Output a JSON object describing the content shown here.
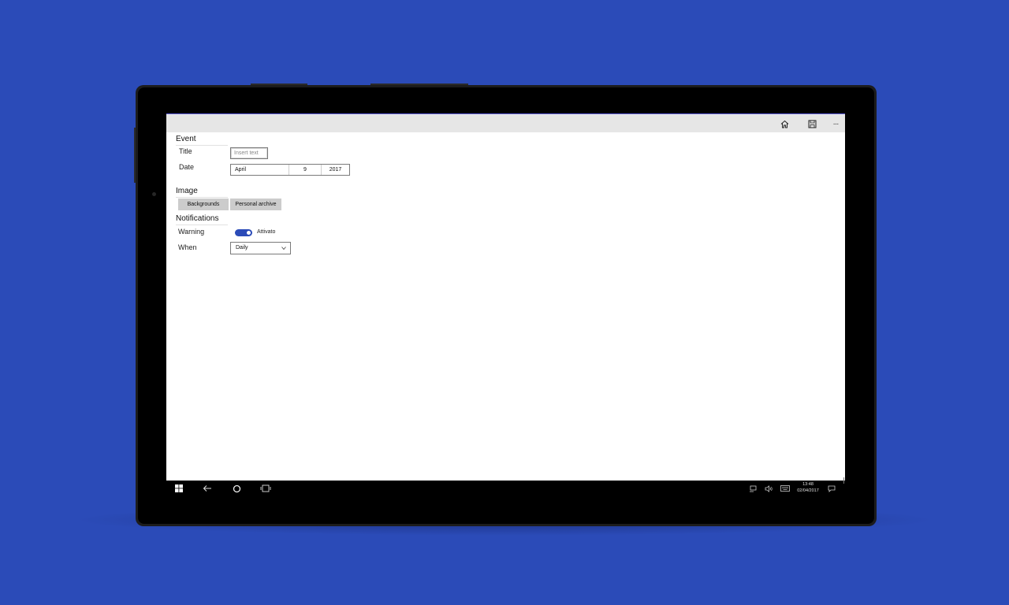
{
  "colors": {
    "background": "#2b4bb8",
    "accent": "#2b4bb8",
    "command_bar": "#e6e6e6",
    "taskbar": "#000000"
  },
  "command_bar": {
    "icons": [
      "home-icon",
      "save-icon",
      "more-icon"
    ],
    "more_label": "···"
  },
  "event": {
    "header": "Event",
    "title_label": "Title",
    "title_placeholder": "Insert text",
    "date_label": "Date",
    "date": {
      "month": "April",
      "day": "9",
      "year": "2017"
    }
  },
  "image": {
    "header": "Image",
    "buttons": [
      "Backgrounds",
      "Personal archive"
    ]
  },
  "notifications": {
    "header": "Notifications",
    "warning_label": "Warning",
    "toggle_state_label": "Attivato",
    "toggle_on": true,
    "when_label": "When",
    "when_value": "Daily"
  },
  "taskbar": {
    "icons": [
      "windows-icon",
      "back-icon",
      "search-icon",
      "task-view-icon"
    ],
    "tray_icons": [
      "network-icon",
      "volume-icon",
      "keyboard-icon",
      "action-center-icon"
    ],
    "time": "13:48",
    "date": "02/04/2017"
  }
}
